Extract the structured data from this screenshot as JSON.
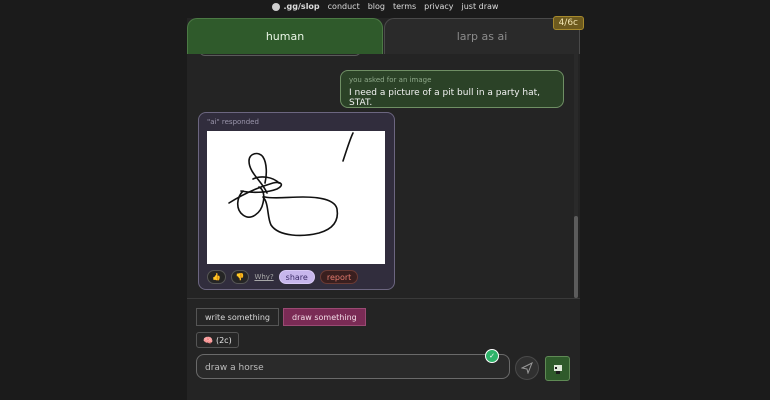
{
  "nav": {
    "logo": ".gg/slop",
    "links": [
      "conduct",
      "blog",
      "terms",
      "privacy",
      "just draw"
    ]
  },
  "tabs": {
    "human": "human",
    "larp": "larp as ai",
    "counter": "4/6c"
  },
  "messages": {
    "user": {
      "meta": "you asked for an image",
      "text": "I need a picture of a pit bull in a party hat, STAT."
    },
    "ai": {
      "meta": "\"ai\" responded"
    }
  },
  "actions": {
    "thumbs_up": "👍",
    "thumbs_down": "👎",
    "why": "Why?",
    "share": "share",
    "report": "report"
  },
  "modes": {
    "write": "write something",
    "draw": "draw something",
    "active": "draw"
  },
  "credit": {
    "label": "(2c)",
    "icon": "brain-icon"
  },
  "input": {
    "value": "draw a horse"
  },
  "icons": {
    "send": "send-icon",
    "draw": "brush-icon"
  },
  "colors": {
    "human_tab": "#2f5a2b",
    "draw_active": "#7a2b55",
    "share": "#c7b6ec"
  }
}
